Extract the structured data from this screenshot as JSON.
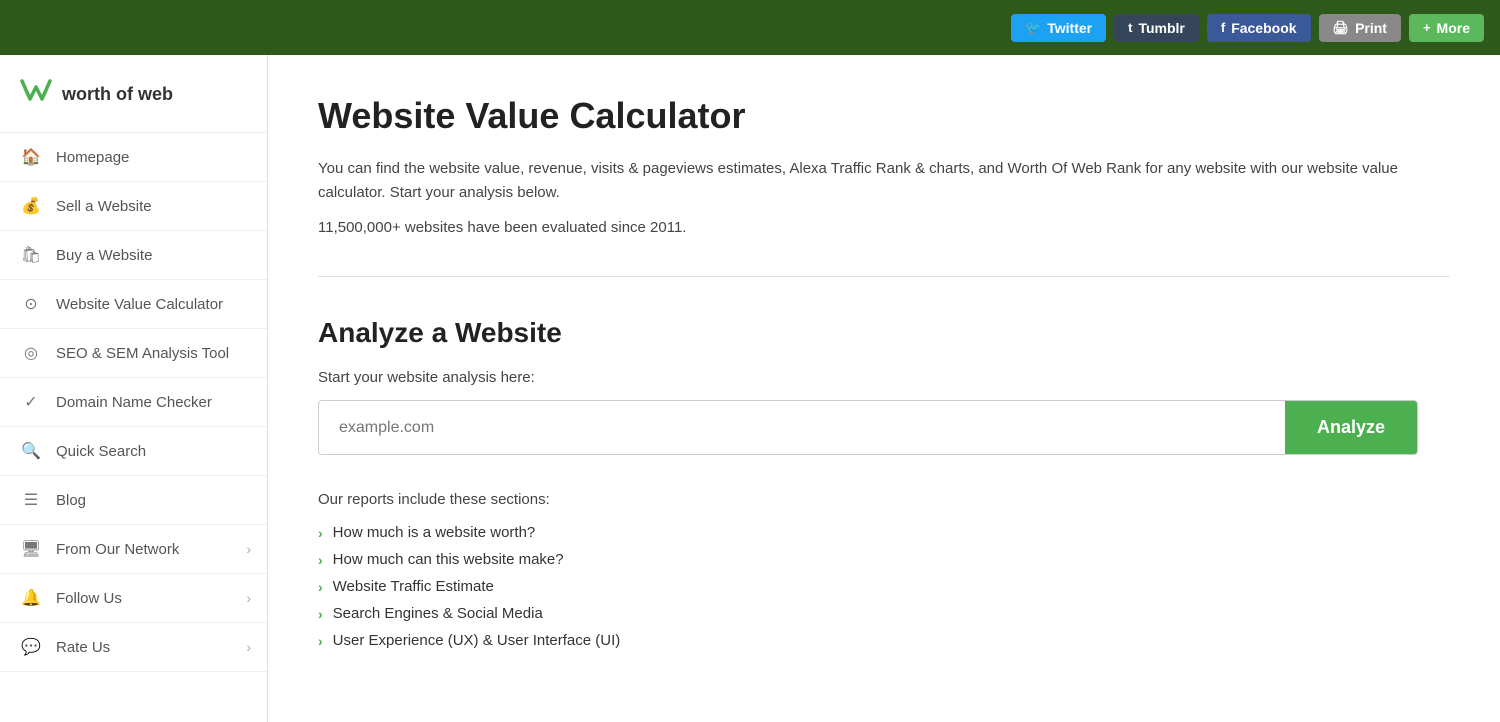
{
  "topbar": {
    "buttons": [
      {
        "id": "twitter",
        "label": "Twitter",
        "icon": "🐦",
        "class": "btn-twitter"
      },
      {
        "id": "tumblr",
        "label": "Tumblr",
        "icon": "t",
        "class": "btn-tumblr"
      },
      {
        "id": "facebook",
        "label": "Facebook",
        "icon": "f",
        "class": "btn-facebook"
      },
      {
        "id": "print",
        "label": "Print",
        "icon": "🖨",
        "class": "btn-print"
      },
      {
        "id": "more",
        "label": "More",
        "icon": "+",
        "class": "btn-more"
      }
    ]
  },
  "sidebar": {
    "logo": {
      "icon": "W",
      "text": "worth of web"
    },
    "nav": [
      {
        "id": "homepage",
        "label": "Homepage",
        "icon": "🏠",
        "hasChevron": false
      },
      {
        "id": "sell-website",
        "label": "Sell a Website",
        "icon": "💰",
        "hasChevron": false
      },
      {
        "id": "buy-website",
        "label": "Buy a Website",
        "icon": "🛍",
        "hasChevron": false
      },
      {
        "id": "website-value",
        "label": "Website Value Calculator",
        "icon": "⊙",
        "hasChevron": false
      },
      {
        "id": "seo-sem",
        "label": "SEO & SEM Analysis Tool",
        "icon": "◎",
        "hasChevron": false
      },
      {
        "id": "domain-checker",
        "label": "Domain Name Checker",
        "icon": "✓",
        "hasChevron": false
      },
      {
        "id": "quick-search",
        "label": "Quick Search",
        "icon": "🔍",
        "hasChevron": false
      },
      {
        "id": "blog",
        "label": "Blog",
        "icon": "☰",
        "hasChevron": false
      },
      {
        "id": "from-network",
        "label": "From Our Network",
        "icon": "🖥",
        "hasChevron": true
      },
      {
        "id": "follow-us",
        "label": "Follow Us",
        "icon": "🔔",
        "hasChevron": true
      },
      {
        "id": "rate-us",
        "label": "Rate Us",
        "icon": "💬",
        "hasChevron": true
      }
    ]
  },
  "main": {
    "title": "Website Value Calculator",
    "description": "You can find the website value, revenue, visits & pageviews estimates, Alexa Traffic Rank & charts, and Worth Of Web Rank for any website with our website value calculator. Start your analysis below.",
    "stat": "11,500,000+ websites have been evaluated since 2011.",
    "analyze_section_title": "Analyze a Website",
    "analyze_start_label": "Start your website analysis here:",
    "analyze_input_placeholder": "example.com",
    "analyze_button_label": "Analyze",
    "reports_intro": "Our reports include these sections:",
    "report_items": [
      "How much is a website worth?",
      "How much can this website make?",
      "Website Traffic Estimate",
      "Search Engines & Social Media",
      "User Experience (UX) & User Interface (UI)"
    ]
  }
}
